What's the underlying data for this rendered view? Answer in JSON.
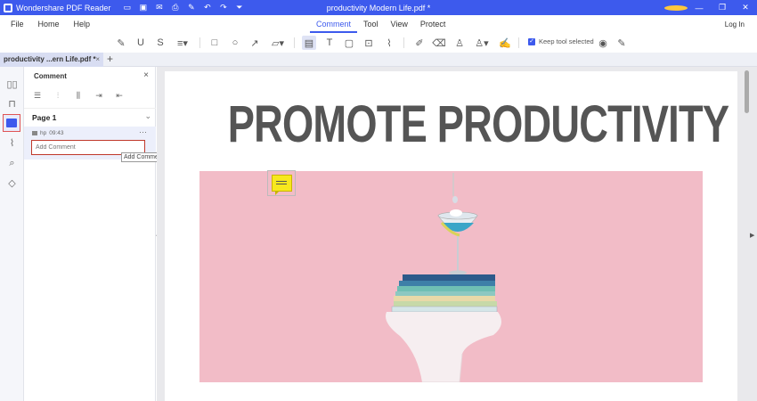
{
  "titlebar": {
    "app_name": "Wondershare PDF Reader",
    "document_title": "productivity Modern Life.pdf *",
    "quick_icons": [
      "folder-icon",
      "save-icon",
      "mail-icon",
      "print-icon",
      "edit-icon",
      "undo-icon",
      "redo-icon",
      "quick-access-icon"
    ],
    "window_controls": [
      "minimize-icon",
      "restore-icon",
      "close-icon"
    ]
  },
  "menu": {
    "left": [
      "File",
      "Home",
      "Help"
    ],
    "center": [
      "Comment",
      "Tool",
      "View",
      "Protect"
    ],
    "active": "Comment",
    "login": "Log In"
  },
  "toolbar": {
    "keep_tool_selected": "Keep tool selected"
  },
  "tab": {
    "label": "productivity ...ern Life.pdf *",
    "close": "×",
    "new": "+"
  },
  "panel": {
    "title": "Comment",
    "page_label": "Page 1",
    "comment": {
      "author": "hp",
      "time": "09:43",
      "placeholder": "Add Comment"
    },
    "tooltip": "Add Comment"
  },
  "page": {
    "headline": "PROMOTE PRODUCTIVITY"
  },
  "colors": {
    "accent": "#3d5aed",
    "photo_bg": "#f2bcc7",
    "sticky_note": "#f7e81e",
    "headline": "#555555"
  }
}
